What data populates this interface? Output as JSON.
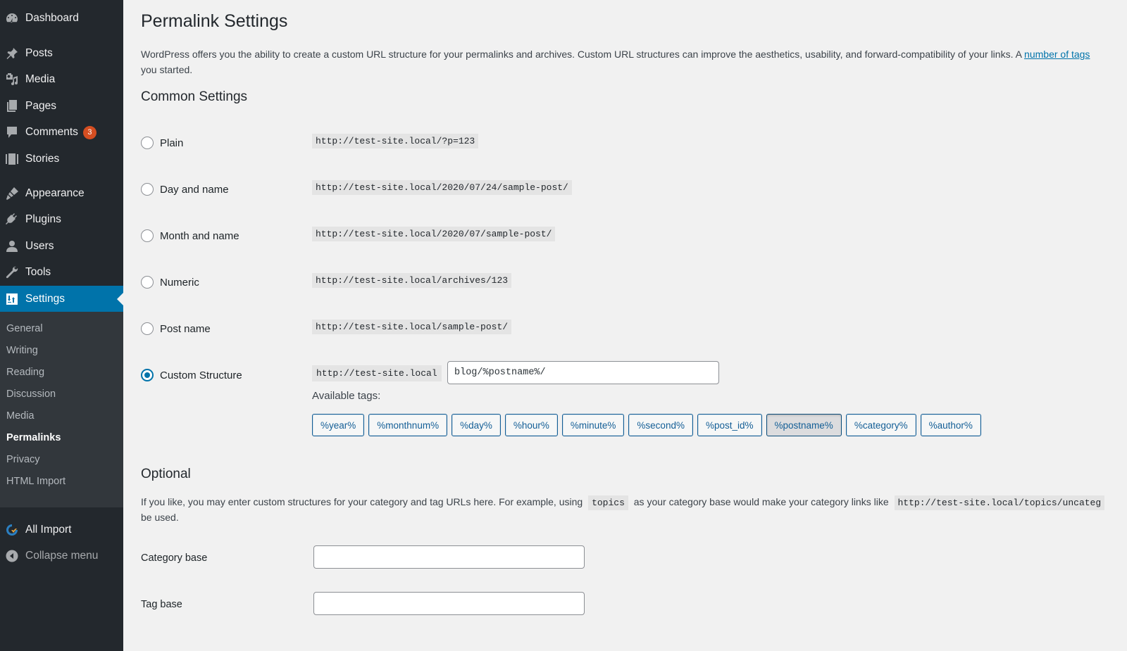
{
  "sidebar": {
    "items": [
      {
        "label": "Dashboard",
        "icon": "dashboard-icon"
      },
      {
        "label": "Posts",
        "icon": "pin-icon"
      },
      {
        "label": "Media",
        "icon": "media-icon"
      },
      {
        "label": "Pages",
        "icon": "pages-icon"
      },
      {
        "label": "Comments",
        "icon": "comment-icon",
        "badge": "3"
      },
      {
        "label": "Stories",
        "icon": "stories-icon"
      },
      {
        "label": "Appearance",
        "icon": "paintbrush-icon"
      },
      {
        "label": "Plugins",
        "icon": "plug-icon"
      },
      {
        "label": "Users",
        "icon": "user-icon"
      },
      {
        "label": "Tools",
        "icon": "wrench-icon"
      },
      {
        "label": "Settings",
        "icon": "settings-sliders-icon",
        "active": true
      }
    ],
    "submenu": [
      {
        "label": "General"
      },
      {
        "label": "Writing"
      },
      {
        "label": "Reading"
      },
      {
        "label": "Discussion"
      },
      {
        "label": "Media"
      },
      {
        "label": "Permalinks",
        "current": true
      },
      {
        "label": "Privacy"
      },
      {
        "label": "HTML Import"
      }
    ],
    "all_import": {
      "label": "All Import",
      "icon": "all-import-icon"
    },
    "collapse": {
      "label": "Collapse menu",
      "icon": "collapse-arrow-icon"
    },
    "colors": {
      "bg": "#23282d",
      "active": "#0073aa",
      "badge": "#d54e21"
    }
  },
  "page": {
    "title": "Permalink Settings",
    "intro_text": "WordPress offers you the ability to create a custom URL structure for your permalinks and archives. Custom URL structures can improve the aesthetics, usability, and forward-compatibility of your links. A ",
    "intro_link": "number of tags",
    "intro_line2": "you started."
  },
  "common_settings": {
    "heading": "Common Settings",
    "options": [
      {
        "label": "Plain",
        "example": "http://test-site.local/?p=123",
        "checked": false
      },
      {
        "label": "Day and name",
        "example": "http://test-site.local/2020/07/24/sample-post/",
        "checked": false
      },
      {
        "label": "Month and name",
        "example": "http://test-site.local/2020/07/sample-post/",
        "checked": false
      },
      {
        "label": "Numeric",
        "example": "http://test-site.local/archives/123",
        "checked": false
      },
      {
        "label": "Post name",
        "example": "http://test-site.local/sample-post/",
        "checked": false
      },
      {
        "label": "Custom Structure",
        "example": "http://test-site.local",
        "checked": true
      }
    ],
    "custom_value": "blog/%postname%/",
    "available_tags_label": "Available tags:",
    "tags": [
      "%year%",
      "%monthnum%",
      "%day%",
      "%hour%",
      "%minute%",
      "%second%",
      "%post_id%",
      "%postname%",
      "%category%",
      "%author%"
    ],
    "active_tag": "%postname%"
  },
  "optional": {
    "heading": "Optional",
    "text_1": "If you like, you may enter custom structures for your category and tag URLs here. For example, using",
    "code_1": "topics",
    "text_2": "as your category base would make your category links like",
    "code_2": "http://test-site.local/topics/uncateg",
    "text_line2": "be used.",
    "category_base_label": "Category base",
    "category_base_value": "",
    "tag_base_label": "Tag base",
    "tag_base_value": ""
  }
}
